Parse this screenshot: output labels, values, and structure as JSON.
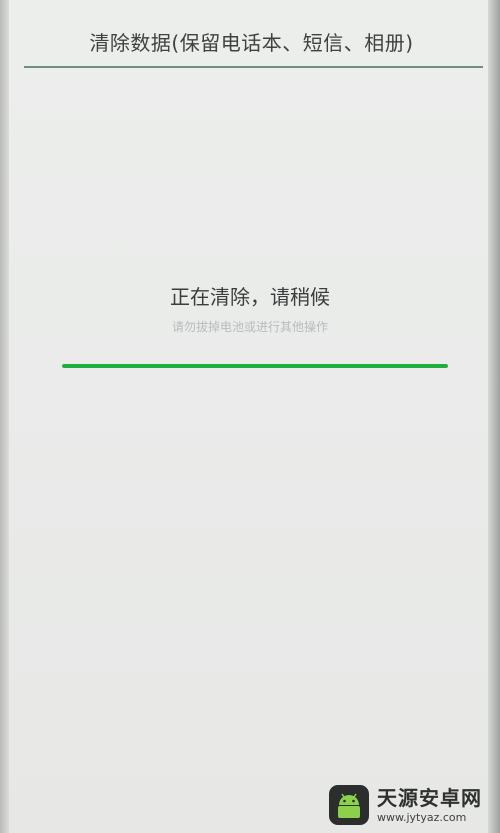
{
  "header": {
    "title": "清除数据(保留电话本、短信、相册)"
  },
  "status": {
    "main_text": "正在清除，请稍候",
    "sub_text": "请勿拔掉电池或进行其他操作"
  },
  "progress": {
    "fraction": 1.0
  },
  "watermark": {
    "name": "天源安卓网",
    "url": "www.jytyaz.com"
  },
  "colors": {
    "progress": "#1fae3c",
    "divider": "#6d8f86",
    "background": "#eceeec"
  }
}
